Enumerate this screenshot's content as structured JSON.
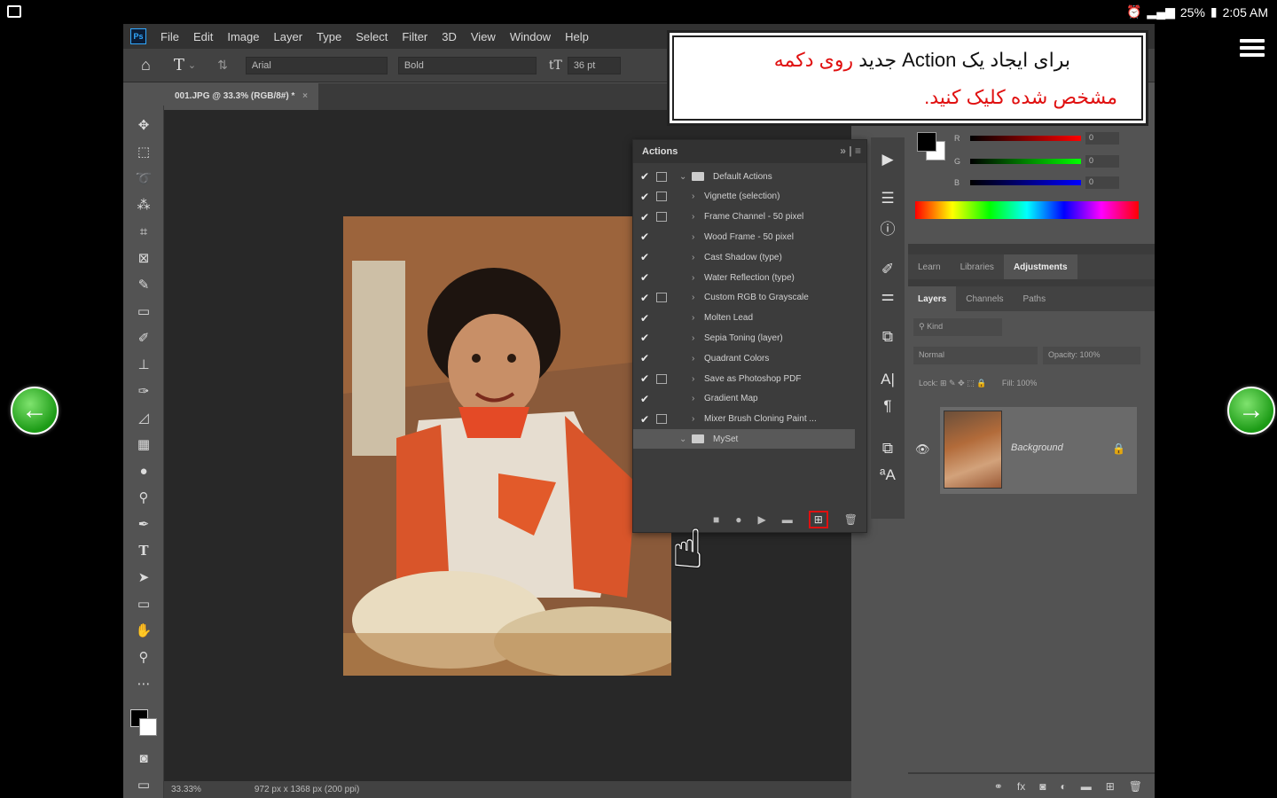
{
  "statusbar": {
    "battery": "25%",
    "time": "2:05 AM"
  },
  "menubar": {
    "logo": "Ps",
    "items": [
      "File",
      "Edit",
      "Image",
      "Layer",
      "Type",
      "Select",
      "Filter",
      "3D",
      "View",
      "Window",
      "Help"
    ]
  },
  "options": {
    "font_family": "Arial",
    "font_style": "Bold",
    "font_size": "36 pt"
  },
  "document": {
    "tab_title": "001.JPG @ 33.3% (RGB/8#) *",
    "zoom": "33.33%",
    "size_info": "972 px x 1368 px (200 ppi)"
  },
  "actions_panel": {
    "title": "Actions",
    "items": [
      {
        "label": "Default Actions",
        "type": "set",
        "dialog": true
      },
      {
        "label": "Vignette (selection)",
        "type": "action",
        "dialog": true
      },
      {
        "label": "Frame Channel - 50 pixel",
        "type": "action",
        "dialog": true
      },
      {
        "label": "Wood Frame - 50 pixel",
        "type": "action",
        "dialog": false
      },
      {
        "label": "Cast Shadow (type)",
        "type": "action",
        "dialog": false
      },
      {
        "label": "Water Reflection (type)",
        "type": "action",
        "dialog": false
      },
      {
        "label": "Custom RGB to Grayscale",
        "type": "action",
        "dialog": true
      },
      {
        "label": "Molten Lead",
        "type": "action",
        "dialog": false
      },
      {
        "label": "Sepia Toning (layer)",
        "type": "action",
        "dialog": false
      },
      {
        "label": "Quadrant Colors",
        "type": "action",
        "dialog": false
      },
      {
        "label": "Save as Photoshop PDF",
        "type": "action",
        "dialog": true
      },
      {
        "label": "Gradient Map",
        "type": "action",
        "dialog": false
      },
      {
        "label": "Mixer Brush Cloning Paint ...",
        "type": "action",
        "dialog": true
      },
      {
        "label": "MySet",
        "type": "set",
        "dialog": false,
        "selected": true
      }
    ]
  },
  "color_panel": {
    "r": "0",
    "g": "0",
    "b": "0",
    "r_label": "R",
    "g_label": "G",
    "b_label": "B"
  },
  "panel_tabs_top": [
    "Learn",
    "Libraries",
    "Adjustments"
  ],
  "panel_tabs_layers": [
    "Layers",
    "Channels",
    "Paths"
  ],
  "layers": {
    "filter_placeholder": "Kind",
    "blend_mode": "Normal",
    "opacity_label": "Opacity:",
    "opacity": "100%",
    "lock_label": "Lock:",
    "fill_label": "Fill:",
    "fill": "100%",
    "layer_name": "Background"
  },
  "callout": {
    "line1_black": "برای ایجاد یک Action جدید",
    "line1_red": "روی دکمه",
    "line2": "مشخص شده کلیک کنید."
  },
  "colors": {
    "callout_red": "#e01010",
    "nav_green": "#1c9b16"
  }
}
